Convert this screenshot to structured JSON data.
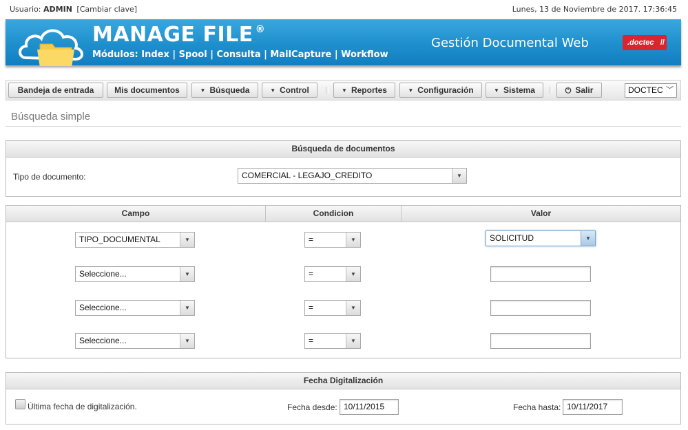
{
  "topbar": {
    "user_label": "Usuario:",
    "user_name": "ADMIN",
    "change_password": "[Cambiar clave]",
    "datetime": "Lunes, 13 de Noviembre de 2017. 17:36:45"
  },
  "banner": {
    "title": "MANAGE FILE",
    "registered": "®",
    "modules": "Módulos: Index | Spool | Consulta | MailCapture | Workflow",
    "subtitle": "Gestión Documental Web",
    "company_logo": ".doctec",
    "brand_color": "#1e8fcd"
  },
  "menu": {
    "inbox": "Bandeja de entrada",
    "my_documents": "Mis documentos",
    "search": "Búsqueda",
    "control": "Control",
    "reports": "Reportes",
    "configuration": "Configuración",
    "system": "Sistema",
    "logout": "Salir",
    "company_selected": "DOCTEC"
  },
  "page_title": "Búsqueda simple",
  "doc_search": {
    "header": "Búsqueda de documentos",
    "doc_type_label": "Tipo de documento:",
    "doc_type_value": "COMERCIAL - LEGAJO_CREDITO"
  },
  "criteria": {
    "col_field": "Campo",
    "col_condition": "Condicion",
    "col_value": "Valor",
    "rows": [
      {
        "field": "TIPO_DOCUMENTAL",
        "condition": "=",
        "value": "SOLICITUD"
      },
      {
        "field": "Seleccione...",
        "condition": "=",
        "value": ""
      },
      {
        "field": "Seleccione...",
        "condition": "=",
        "value": ""
      },
      {
        "field": "Seleccione...",
        "condition": "=",
        "value": ""
      }
    ]
  },
  "digitization": {
    "header": "Fecha Digitalización",
    "last_date_label": "Última fecha de digitalización.",
    "from_label": "Fecha desde:",
    "from_value": "10/11/2015",
    "to_label": "Fecha hasta:",
    "to_value": "10/11/2017"
  }
}
